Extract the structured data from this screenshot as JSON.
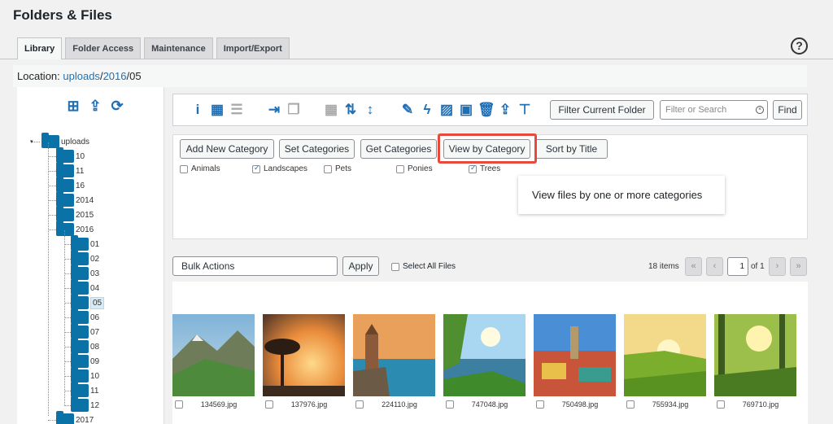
{
  "page": {
    "title": "Folders & Files"
  },
  "tabs": [
    {
      "label": "Library",
      "active": true
    },
    {
      "label": "Folder Access"
    },
    {
      "label": "Maintenance"
    },
    {
      "label": "Import/Export"
    }
  ],
  "help_icon": {
    "symbol": "?",
    "name": "help-icon"
  },
  "location": {
    "label": "Location:",
    "crumb1": "uploads",
    "sep1": "/",
    "crumb2": "2016",
    "sep2": "/",
    "crumb3": "05"
  },
  "tree_actions": [
    {
      "icon": "add-folder-icon",
      "glyph": "⊞"
    },
    {
      "icon": "upload-icon",
      "glyph": "⇪"
    },
    {
      "icon": "refresh-icon",
      "glyph": "⟳"
    }
  ],
  "tree": {
    "root": "uploads",
    "level1": [
      "10",
      "11",
      "16",
      "2014",
      "2015",
      "2016"
    ],
    "level2": [
      "01",
      "02",
      "03",
      "04",
      "05",
      "06",
      "07",
      "08",
      "09",
      "10",
      "11",
      "12"
    ],
    "last": "2017",
    "selected": "05"
  },
  "toolbar": {
    "icons": [
      {
        "name": "info-icon",
        "glyph": "i"
      },
      {
        "name": "grid-view-icon",
        "glyph": "▦"
      },
      {
        "name": "list-view-icon",
        "glyph": "☰",
        "disabled": true
      },
      {
        "name": "move-icon",
        "glyph": "⇥"
      },
      {
        "name": "copy-icon",
        "glyph": "❐",
        "disabled": true
      },
      {
        "name": "calendar-icon",
        "glyph": "▦",
        "disabled": true
      },
      {
        "name": "sort-file-icon",
        "glyph": "⇅"
      },
      {
        "name": "sort-arrows-icon",
        "glyph": "↕"
      },
      {
        "name": "edit-icon",
        "glyph": "✎"
      },
      {
        "name": "bolt-icon",
        "glyph": "ϟ"
      },
      {
        "name": "image-icon",
        "glyph": "▨"
      },
      {
        "name": "thumbnail-icon",
        "glyph": "▣"
      },
      {
        "name": "trash-icon",
        "glyph": "🗑"
      },
      {
        "name": "upload-file-icon",
        "glyph": "⇪"
      },
      {
        "name": "sitemap-icon",
        "glyph": "⊤"
      }
    ],
    "filter_button": "Filter Current Folder",
    "search_placeholder": "Filter or Search",
    "find_button": "Find"
  },
  "categories": {
    "buttons": [
      "Add New Category",
      "Set Categories",
      "Get Categories",
      "View by Category",
      "Sort by Title"
    ],
    "options": [
      {
        "label": "Animals",
        "checked": false
      },
      {
        "label": "Landscapes",
        "checked": true
      },
      {
        "label": "Pets",
        "checked": false
      },
      {
        "label": "Ponies",
        "checked": false
      },
      {
        "label": "Trees",
        "checked": true
      }
    ],
    "tooltip": "View files by one or more categories"
  },
  "bulk": {
    "label": "Bulk Actions",
    "apply": "Apply",
    "select_all": "Select All Files"
  },
  "pagination": {
    "items": "18 items",
    "first": "«",
    "prev": "‹",
    "current": "1",
    "of": "of 1",
    "next": "›",
    "last": "»"
  },
  "files": [
    {
      "name": "134569.jpg"
    },
    {
      "name": "137976.jpg"
    },
    {
      "name": "224110.jpg"
    },
    {
      "name": "747048.jpg"
    },
    {
      "name": "750498.jpg"
    },
    {
      "name": "755934.jpg"
    },
    {
      "name": "769710.jpg"
    }
  ],
  "colors": {
    "accent": "#2271b1",
    "folder": "#0b72a8",
    "highlight": "#e64a3c"
  }
}
